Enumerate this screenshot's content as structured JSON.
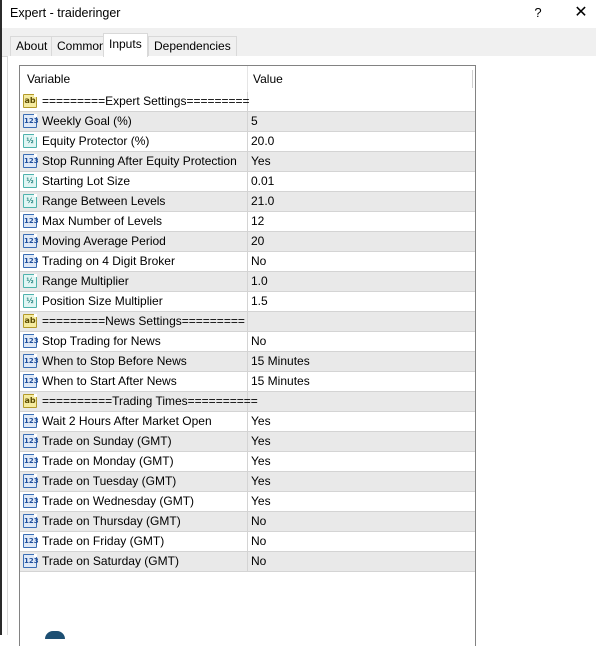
{
  "window": {
    "title": "Expert - traideringer",
    "help_label": "?",
    "close_label": "✕"
  },
  "tabs": [
    {
      "label": "About",
      "active": false
    },
    {
      "label": "Common",
      "active": false
    },
    {
      "label": "Inputs",
      "active": true
    },
    {
      "label": "Dependencies",
      "active": false
    }
  ],
  "grid": {
    "columns": [
      "Variable",
      "Value"
    ],
    "rows": [
      {
        "type": "string",
        "icon": "ab",
        "variable": "=========Expert Settings=========",
        "value": ""
      },
      {
        "type": "int",
        "icon": "123",
        "variable": "Weekly Goal (%)",
        "value": "5"
      },
      {
        "type": "double",
        "icon": "½",
        "variable": "Equity Protector (%)",
        "value": "20.0"
      },
      {
        "type": "int",
        "icon": "123",
        "variable": "Stop Running After Equity Protection",
        "value": "Yes"
      },
      {
        "type": "double",
        "icon": "½",
        "variable": "Starting Lot Size",
        "value": "0.01"
      },
      {
        "type": "double",
        "icon": "½",
        "variable": "Range Between Levels",
        "value": "21.0"
      },
      {
        "type": "int",
        "icon": "123",
        "variable": "Max Number of Levels",
        "value": "12"
      },
      {
        "type": "int",
        "icon": "123",
        "variable": "Moving Average Period",
        "value": "20"
      },
      {
        "type": "int",
        "icon": "123",
        "variable": "Trading on 4 Digit Broker",
        "value": "No"
      },
      {
        "type": "double",
        "icon": "½",
        "variable": "Range Multiplier",
        "value": "1.0"
      },
      {
        "type": "double",
        "icon": "½",
        "variable": "Position Size Multiplier",
        "value": "1.5"
      },
      {
        "type": "string",
        "icon": "ab",
        "variable": "=========News Settings=========",
        "value": ""
      },
      {
        "type": "int",
        "icon": "123",
        "variable": "Stop Trading for News",
        "value": "No"
      },
      {
        "type": "int",
        "icon": "123",
        "variable": "When to Stop Before News",
        "value": "15 Minutes"
      },
      {
        "type": "int",
        "icon": "123",
        "variable": "When to Start After News",
        "value": "15 Minutes"
      },
      {
        "type": "string",
        "icon": "ab",
        "variable": "==========Trading Times==========",
        "value": ""
      },
      {
        "type": "int",
        "icon": "123",
        "variable": "Wait 2 Hours After Market Open",
        "value": "Yes"
      },
      {
        "type": "int",
        "icon": "123",
        "variable": "Trade on Sunday (GMT)",
        "value": "Yes"
      },
      {
        "type": "int",
        "icon": "123",
        "variable": "Trade on Monday (GMT)",
        "value": "Yes"
      },
      {
        "type": "int",
        "icon": "123",
        "variable": "Trade on Tuesday (GMT)",
        "value": "Yes"
      },
      {
        "type": "int",
        "icon": "123",
        "variable": "Trade on Wednesday (GMT)",
        "value": "Yes"
      },
      {
        "type": "int",
        "icon": "123",
        "variable": "Trade on Thursday (GMT)",
        "value": "No"
      },
      {
        "type": "int",
        "icon": "123",
        "variable": "Trade on Friday (GMT)",
        "value": "No"
      },
      {
        "type": "int",
        "icon": "123",
        "variable": "Trade on Saturday (GMT)",
        "value": "No"
      }
    ]
  }
}
